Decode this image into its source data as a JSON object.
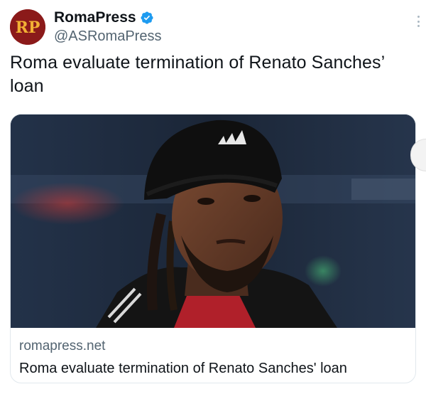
{
  "account": {
    "display_name": "RomaPress",
    "handle": "@ASRomaPress",
    "verified": true,
    "avatar_text": "RP"
  },
  "tweet": {
    "text": "Roma evaluate termination of Renato Sanches’ loan"
  },
  "link_card": {
    "domain": "romapress.net",
    "title": "Roma evaluate termination of Renato Sanches' loan",
    "image_subject": "photo of a player wearing a black beanie and dark jacket"
  },
  "colors": {
    "avatar_bg": "#8b1a1a",
    "avatar_letters": "#f2b134",
    "verified_badge": "#1d9bf0",
    "secondary_text": "#536471",
    "primary_text": "#0f1419"
  }
}
